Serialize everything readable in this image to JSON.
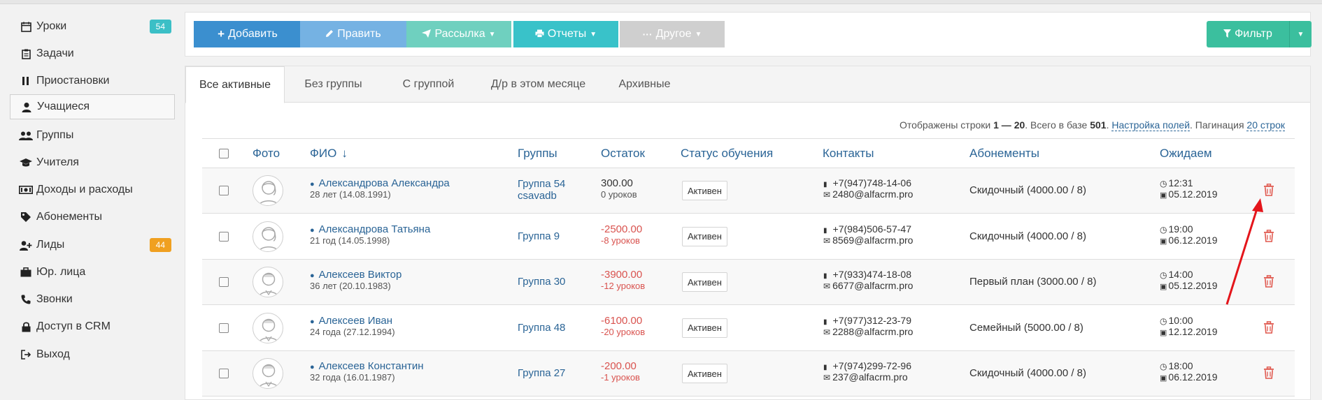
{
  "sidebar": {
    "items": [
      {
        "label": "Уроки",
        "icon": "calendar-icon",
        "badge": "54",
        "badge_color": "#3bbfc6"
      },
      {
        "label": "Задачи",
        "icon": "clipboard-icon"
      },
      {
        "label": "Приостановки",
        "icon": "pause-icon"
      },
      {
        "label": "Учащиеся",
        "icon": "user-icon",
        "active": true
      },
      {
        "label": "Группы",
        "icon": "users-icon"
      },
      {
        "label": "Учителя",
        "icon": "graduation-cap-icon"
      },
      {
        "label": "Доходы и расходы",
        "icon": "money-icon"
      },
      {
        "label": "Абонементы",
        "icon": "tags-icon"
      },
      {
        "label": "Лиды",
        "icon": "user-plus-icon",
        "badge": "44",
        "badge_color": "#f0a020"
      },
      {
        "label": "Юр. лица",
        "icon": "briefcase-icon"
      },
      {
        "label": "Звонки",
        "icon": "phone-icon"
      },
      {
        "label": "Доступ в CRM",
        "icon": "lock-icon"
      },
      {
        "label": "Выход",
        "icon": "sign-out-icon"
      }
    ]
  },
  "toolbar": {
    "add_label": "Добавить",
    "edit_label": "Править",
    "mailing_label": "Рассылка",
    "reports_label": "Отчеты",
    "other_label": "Другое",
    "filter_label": "Фильтр",
    "colors": {
      "add": "#3b8fcf",
      "edit": "#75b2e3",
      "mailing": "#6fd0bf",
      "reports": "#39c2c9",
      "other": "#cfcfcf",
      "filter": "#3bbf9e"
    }
  },
  "tabs": [
    "Все активные",
    "Без группы",
    "С группой",
    "Д/р в этом месяце",
    "Архивные"
  ],
  "info": {
    "prefix": "Отображены строки ",
    "range": "1 — 20",
    "middle": ". Всего в базе ",
    "total": "501",
    "dot": ".",
    "fields_link": "Настройка полей",
    "pagination_label": ". Пагинация ",
    "pagination_link": "20 строк"
  },
  "table": {
    "headers": {
      "photo": "Фото",
      "fio": "ФИО",
      "fio_sort": "↓",
      "groups": "Группы",
      "balance": "Остаток",
      "status": "Статус обучения",
      "contacts": "Контакты",
      "subscriptions": "Абонементы",
      "expected": "Ожидаем"
    },
    "rows": [
      {
        "name": "Александрова Александра",
        "age": "28 лет (14.08.1991)",
        "group1": "Группа 54",
        "group2": "csavadb",
        "balance": "300.00",
        "lessons": "0 уроков",
        "negative": false,
        "status": "Активен",
        "phone": "+7(947)748-14-06",
        "email": "2480@alfacrm.pro",
        "subscription": "Скидочный (4000.00 / 8)",
        "time": "12:31",
        "date": "05.12.2019",
        "gender": "f"
      },
      {
        "name": "Александрова Татьяна",
        "age": "21 год (14.05.1998)",
        "group1": "Группа 9",
        "group2": "",
        "balance": "-2500.00",
        "lessons": "-8 уроков",
        "negative": true,
        "status": "Активен",
        "phone": "+7(984)506-57-47",
        "email": "8569@alfacrm.pro",
        "subscription": "Скидочный (4000.00 / 8)",
        "time": "19:00",
        "date": "06.12.2019",
        "gender": "f"
      },
      {
        "name": "Алексеев Виктор",
        "age": "36 лет (20.10.1983)",
        "group1": "Группа 30",
        "group2": "",
        "balance": "-3900.00",
        "lessons": "-12 уроков",
        "negative": true,
        "status": "Активен",
        "phone": "+7(933)474-18-08",
        "email": "6677@alfacrm.pro",
        "subscription": "Первый план (3000.00 / 8)",
        "time": "14:00",
        "date": "05.12.2019",
        "gender": "m"
      },
      {
        "name": "Алексеев Иван",
        "age": "24 года (27.12.1994)",
        "group1": "Группа 48",
        "group2": "",
        "balance": "-6100.00",
        "lessons": "-20 уроков",
        "negative": true,
        "status": "Активен",
        "phone": "+7(977)312-23-79",
        "email": "2288@alfacrm.pro",
        "subscription": "Семейный (5000.00 / 8)",
        "time": "10:00",
        "date": "12.12.2019",
        "gender": "m"
      },
      {
        "name": "Алексеев Константин",
        "age": "32 года (16.01.1987)",
        "group1": "Группа 27",
        "group2": "",
        "balance": "-200.00",
        "lessons": "-1 уроков",
        "negative": true,
        "status": "Активен",
        "phone": "+7(974)299-72-96",
        "email": "237@alfacrm.pro",
        "subscription": "Скидочный (4000.00 / 8)",
        "time": "18:00",
        "date": "06.12.2019",
        "gender": "m"
      }
    ]
  }
}
